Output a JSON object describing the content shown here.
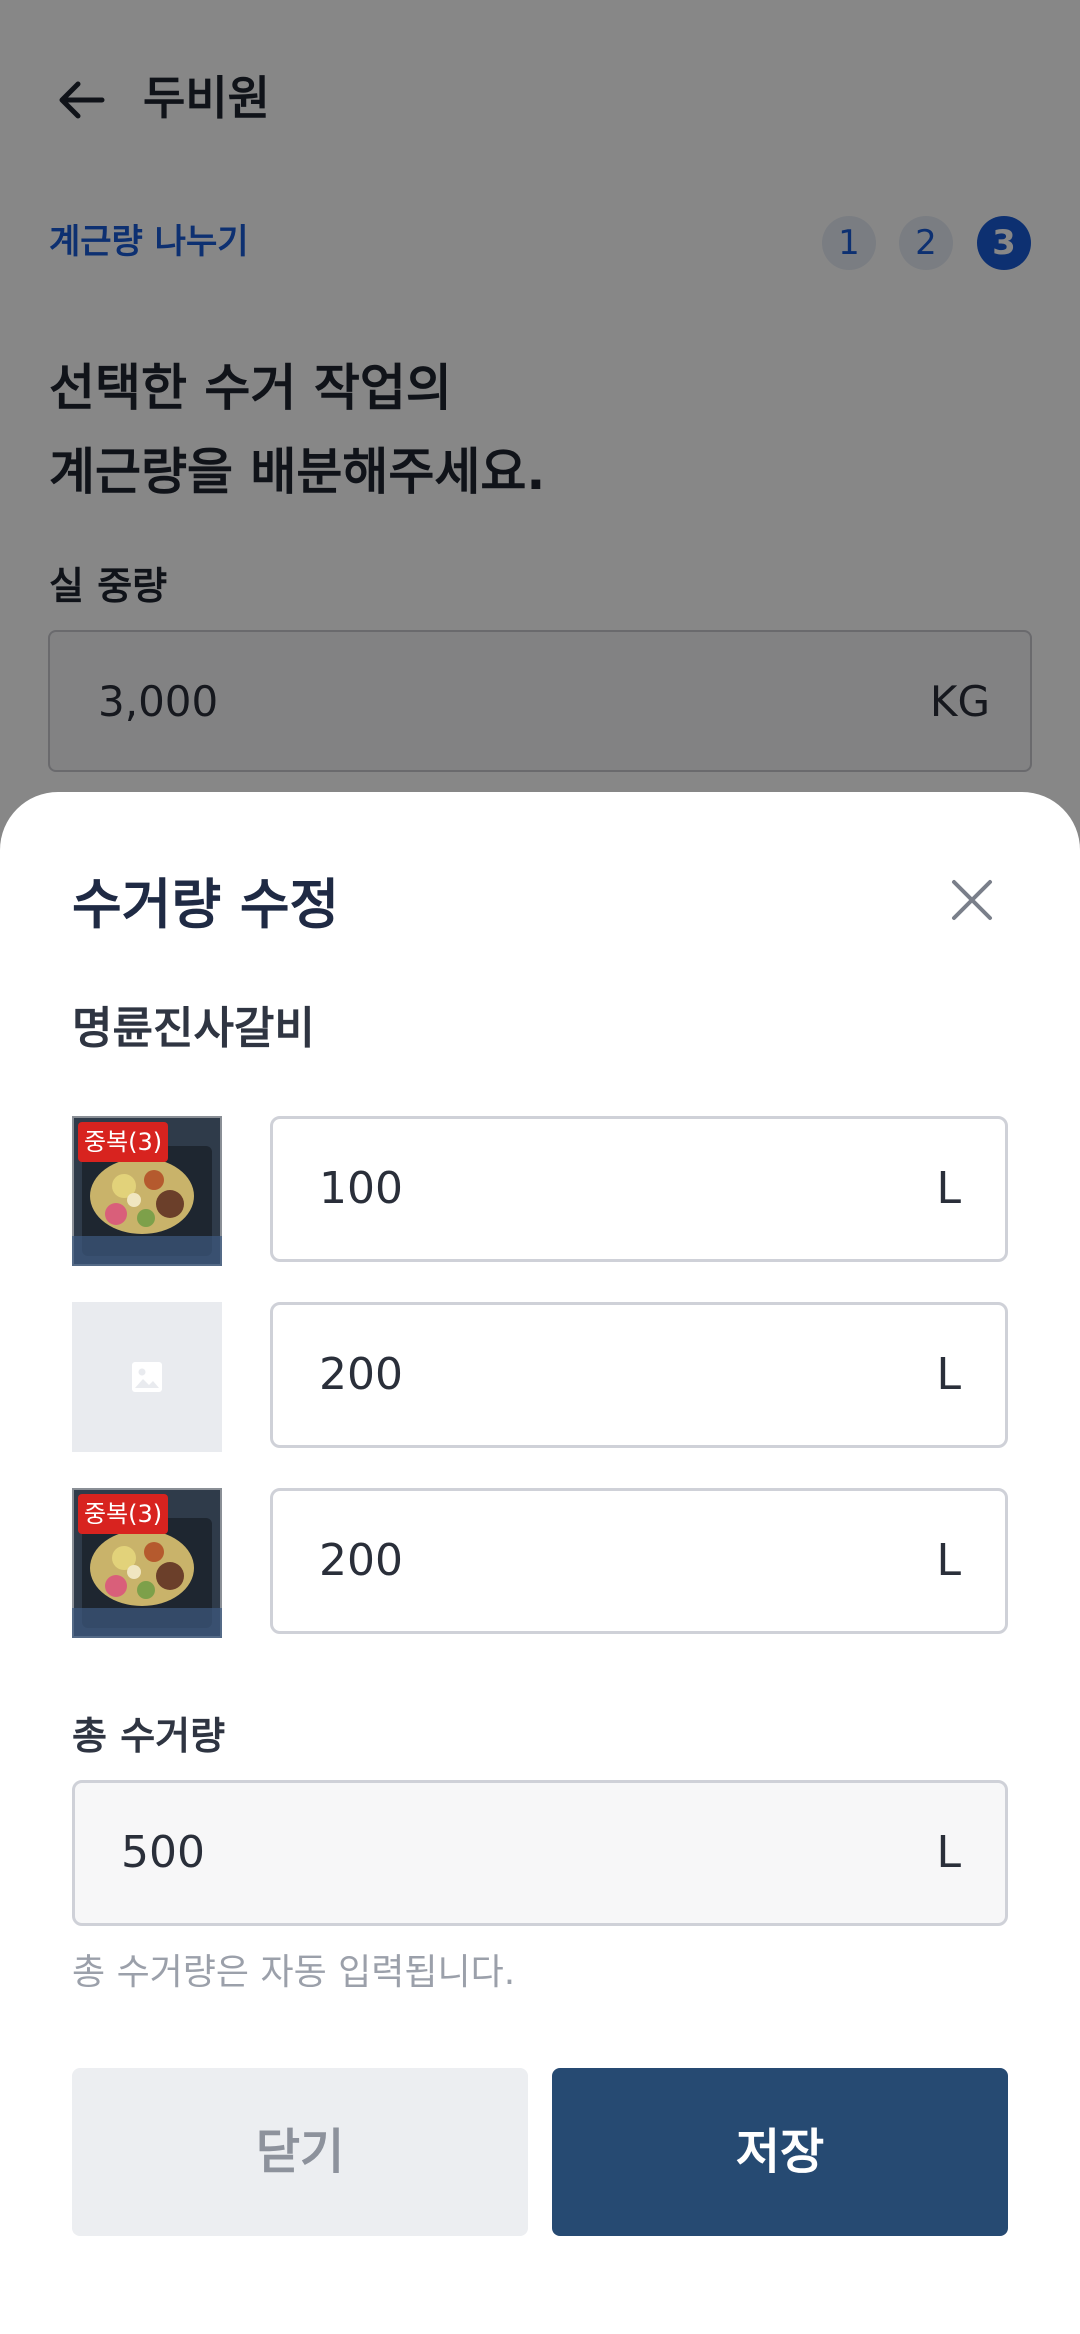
{
  "header": {
    "title": "두비원"
  },
  "steps": {
    "label": "계근량 나누기",
    "items": [
      "1",
      "2",
      "3"
    ]
  },
  "main": {
    "heading_line1": "선택한 수거 작업의",
    "heading_line2": "계근량을 배분해주세요.",
    "weight_label": "실 중량",
    "weight_value": "3,000",
    "weight_unit": "KG"
  },
  "sheet": {
    "title": "수거량 수정",
    "store_name": "명륜진사갈비",
    "rows": [
      {
        "badge": "중복(3)",
        "value": "100",
        "unit": "L",
        "has_photo": true
      },
      {
        "badge": "",
        "value": "200",
        "unit": "L",
        "has_photo": false
      },
      {
        "badge": "중복(3)",
        "value": "200",
        "unit": "L",
        "has_photo": true
      }
    ],
    "total_label": "총 수거량",
    "total_value": "500",
    "total_unit": "L",
    "total_hint": "총 수거량은 자동 입력됩니다.",
    "close_button": "닫기",
    "save_button": "저장"
  },
  "colors": {
    "accent_blue": "#1a5bd6",
    "primary_button": "#264a72",
    "badge_red": "#d8231f",
    "overlay": "rgba(0,0,0,0.47)"
  },
  "icons": {
    "back": "arrow-left-icon",
    "close": "close-icon",
    "placeholder": "image-placeholder-icon"
  }
}
